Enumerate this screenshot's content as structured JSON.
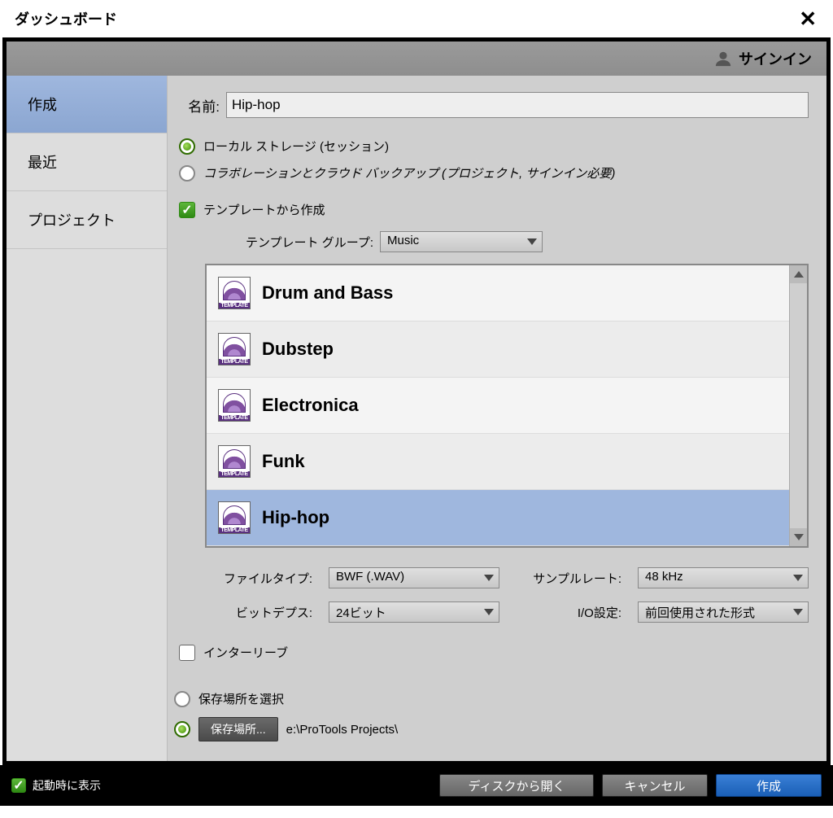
{
  "window": {
    "title": "ダッシュボード"
  },
  "signin": {
    "label": "サインイン"
  },
  "sidebar": {
    "tabs": [
      {
        "label": "作成",
        "active": true
      },
      {
        "label": "最近",
        "active": false
      },
      {
        "label": "プロジェクト",
        "active": false
      }
    ]
  },
  "name": {
    "label": "名前:",
    "value": "Hip-hop"
  },
  "storage": {
    "local_label": "ローカル ストレージ (セッション)",
    "cloud_label": "コラボレーションとクラウド バックアップ (プロジェクト, サインイン必要)",
    "selected": "local"
  },
  "template": {
    "create_from_label": "テンプレートから作成",
    "checked": true,
    "group_label": "テンプレート グループ:",
    "group_value": "Music",
    "icon_caption": "TEMPLATE",
    "items": [
      {
        "label": "Drum and Bass",
        "selected": false
      },
      {
        "label": "Dubstep",
        "selected": false
      },
      {
        "label": "Electronica",
        "selected": false
      },
      {
        "label": "Funk",
        "selected": false
      },
      {
        "label": "Hip-hop",
        "selected": true
      }
    ]
  },
  "settings": {
    "file_type_label": "ファイルタイプ:",
    "file_type_value": "BWF (.WAV)",
    "sample_rate_label": "サンプルレート:",
    "sample_rate_value": "48 kHz",
    "bit_depth_label": "ビットデプス:",
    "bit_depth_value": "24ビット",
    "io_label": "I/O設定:",
    "io_value": "前回使用された形式"
  },
  "interleave": {
    "label": "インターリーブ",
    "checked": false
  },
  "save": {
    "choose_label": "保存場所を選択",
    "button_label": "保存場所...",
    "path": "e:\\ProTools Projects\\",
    "selected": "button"
  },
  "footer": {
    "show_on_startup_label": "起動時に表示",
    "show_on_startup_checked": true,
    "open_from_disk": "ディスクから開く",
    "cancel": "キャンセル",
    "create": "作成"
  }
}
